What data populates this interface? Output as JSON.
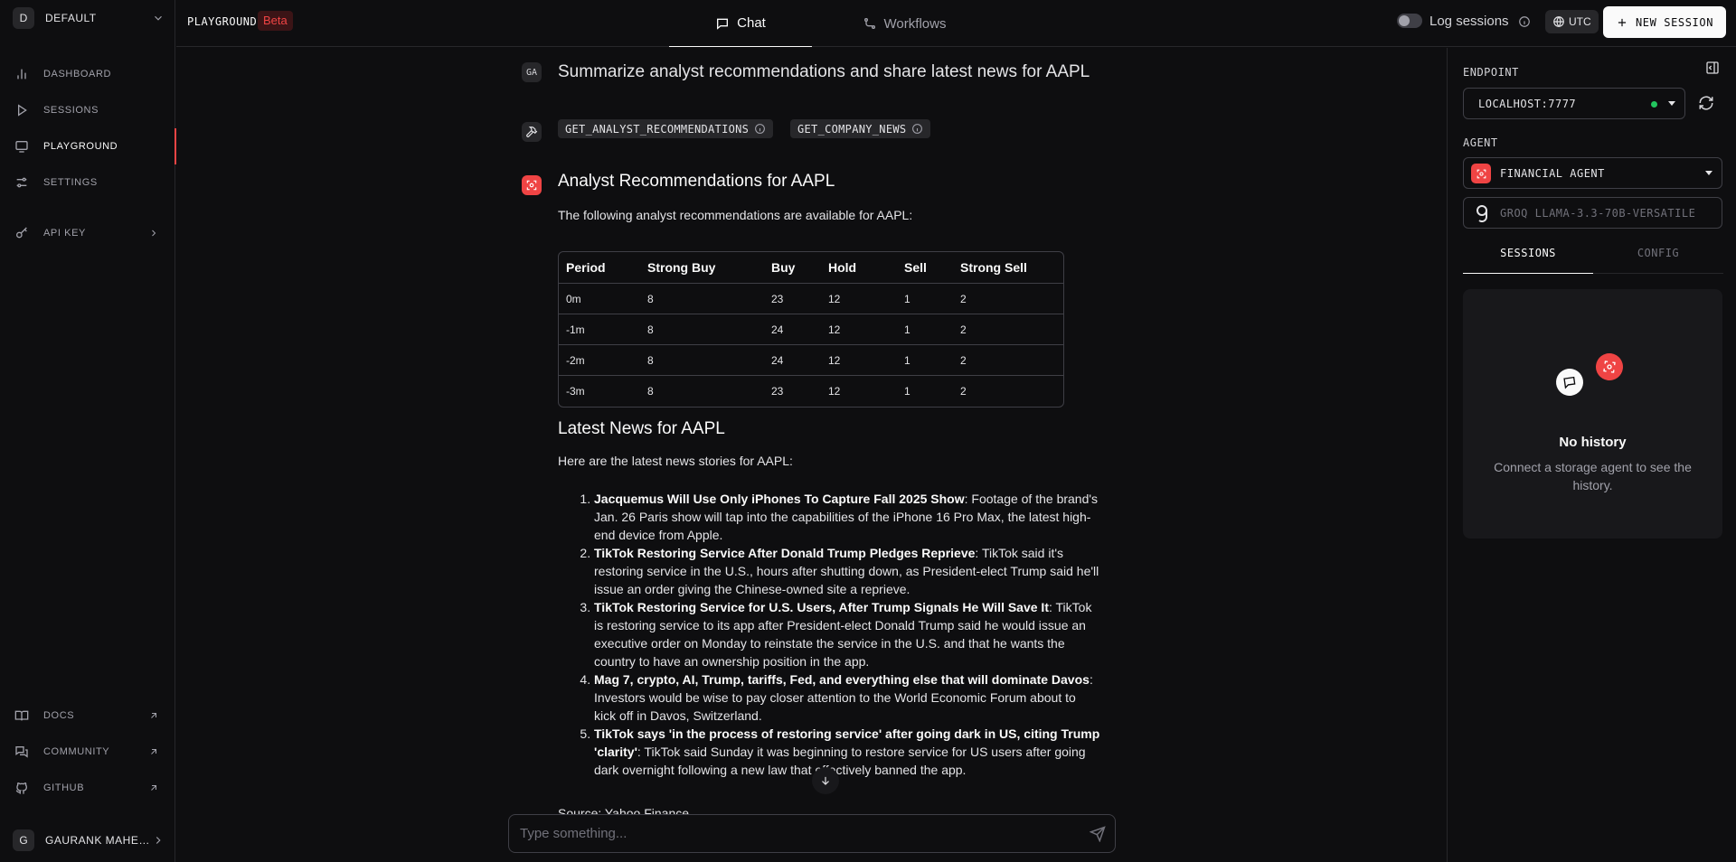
{
  "sidebar": {
    "workspace": {
      "initial": "D",
      "name": "DEFAULT"
    },
    "nav": [
      {
        "label": "DASHBOARD"
      },
      {
        "label": "SESSIONS"
      },
      {
        "label": "PLAYGROUND"
      },
      {
        "label": "SETTINGS"
      },
      {
        "label": "API KEY"
      }
    ],
    "links": [
      {
        "label": "DOCS"
      },
      {
        "label": "COMMUNITY"
      },
      {
        "label": "GITHUB"
      }
    ],
    "user": {
      "initial": "G",
      "name": "GAURANK MAHESHWARI"
    }
  },
  "header": {
    "title": "PLAYGROUND",
    "badge": "Beta",
    "tabs": [
      {
        "label": "Chat",
        "active": true
      },
      {
        "label": "Workflows",
        "active": false
      }
    ],
    "log_sessions_label": "Log sessions",
    "timezone": "UTC",
    "new_session_label": "NEW SESSION"
  },
  "chat": {
    "user_initials": "GA",
    "user_message": "Summarize analyst recommendations and share latest news for AAPL",
    "tools": [
      "GET_ANALYST_RECOMMENDATIONS",
      "GET_COMPANY_NEWS"
    ],
    "response": {
      "heading1": "Analyst Recommendations for AAPL",
      "intro1": "The following analyst recommendations are available for AAPL:",
      "table": {
        "headers": [
          "Period",
          "Strong Buy",
          "Buy",
          "Hold",
          "Sell",
          "Strong Sell"
        ],
        "rows": [
          [
            "0m",
            "8",
            "23",
            "12",
            "1",
            "2"
          ],
          [
            "-1m",
            "8",
            "24",
            "12",
            "1",
            "2"
          ],
          [
            "-2m",
            "8",
            "24",
            "12",
            "1",
            "2"
          ],
          [
            "-3m",
            "8",
            "23",
            "12",
            "1",
            "2"
          ]
        ]
      },
      "heading2": "Latest News for AAPL",
      "intro2": "Here are the latest news stories for AAPL:",
      "news": [
        {
          "title": "Jacquemus Will Use Only iPhones To Capture Fall 2025 Show",
          "text": ": Footage of the brand's Jan. 26 Paris show will tap into the capabilities of the iPhone 16 Pro Max, the latest high-end device from Apple."
        },
        {
          "title": "TikTok Restoring Service After Donald Trump Pledges Reprieve",
          "text": ": TikTok said it's restoring service in the U.S., hours after shutting down, as President-elect Trump said he'll issue an order giving the Chinese-owned site a reprieve."
        },
        {
          "title": "TikTok Restoring Service for U.S. Users, After Trump Signals He Will Save It",
          "text": ": TikTok is restoring service to its app after President-elect Donald Trump said he would issue an executive order on Monday to reinstate the service in the U.S. and that he wants the country to have an ownership position in the app."
        },
        {
          "title": "Mag 7, crypto, AI, Trump, tariffs, Fed, and everything else that will dominate Davos",
          "text": ": Investors would be wise to pay closer attention to the World Economic Forum about to kick off in Davos, Switzerland."
        },
        {
          "title": "TikTok says 'in the process of restoring service' after going dark in US, citing Trump 'clarity'",
          "text": ": TikTok said Sunday it was beginning to restore service for US users after going dark overnight following a new law that effectively banned the app."
        }
      ],
      "source": "Source: Yahoo Finance"
    },
    "input_placeholder": "Type something..."
  },
  "right_panel": {
    "endpoint_label": "ENDPOINT",
    "endpoint_value": "LOCALHOST:7777",
    "agent_label": "AGENT",
    "agent_value": "FINANCIAL AGENT",
    "model_value": "GROQ LLAMA-3.3-70B-VERSATILE",
    "tabs": [
      {
        "label": "SESSIONS",
        "active": true
      },
      {
        "label": "CONFIG",
        "active": false
      }
    ],
    "empty_title": "No history",
    "empty_subtitle": "Connect a storage agent to see the history."
  },
  "colors": {
    "accent": "#ef4444",
    "status_ok": "#22c55e",
    "background": "#0e0e10"
  }
}
